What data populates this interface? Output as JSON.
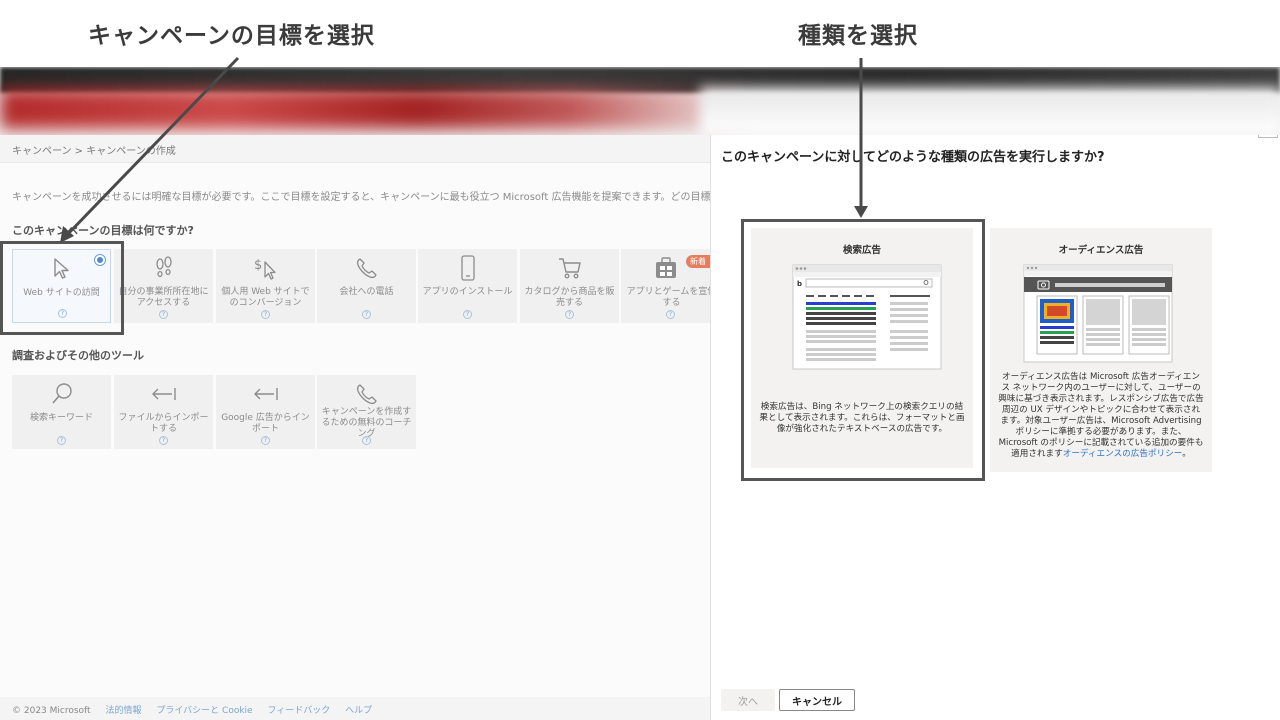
{
  "annotations": {
    "left_title": "キャンペーンの目標を選択",
    "right_title": "種類を選択"
  },
  "breadcrumb": "キャンペーン > キャンペーンの作成",
  "intro": "キャンペーンを成功させるには明確な目標が必要です。ここで目標を設定すると、キャンペーンに最も役立つ Microsoft 広告機能を提案できます。どの目標を選択して",
  "goals": {
    "heading": "このキャンペーンの目標は何ですか?",
    "new_badge": "新着",
    "items": [
      {
        "label": "Web サイトの訪問",
        "icon": "cursor-icon"
      },
      {
        "label": "自分の事業所所在地にアクセスする",
        "icon": "footprints-icon"
      },
      {
        "label": "個人用 Web サイトでのコンバージョン",
        "icon": "dollar-cursor-icon"
      },
      {
        "label": "会社への電話",
        "icon": "phone-icon"
      },
      {
        "label": "アプリのインストール",
        "icon": "mobile-icon"
      },
      {
        "label": "カタログから商品を販売する",
        "icon": "cart-icon"
      },
      {
        "label": "アプリとゲームを宣伝する",
        "icon": "game-icon"
      }
    ],
    "help_glyph": "?"
  },
  "tools": {
    "heading": "調査およびその他のツール",
    "items": [
      {
        "label": "検索キーワード",
        "icon": "search-icon"
      },
      {
        "label": "ファイルからインポートする",
        "icon": "import-icon"
      },
      {
        "label": "Google 広告からインポート",
        "icon": "import-icon"
      },
      {
        "label": "キャンペーンを作成するための無料のコーチング",
        "icon": "phone-icon"
      }
    ]
  },
  "footer": {
    "copyright": "© 2023 Microsoft",
    "links": [
      "法的情報",
      "プライバシーと Cookie",
      "フィードバック",
      "ヘルプ"
    ]
  },
  "panel": {
    "question": "このキャンペーンに対してどのような種類の広告を実行しますか?",
    "search_card": {
      "title": "検索広告",
      "description": "検索広告は、Bing ネットワーク上の検索クエリの結果として表示されます。これらは、フォーマットと画像が強化されたテキストベースの広告です。"
    },
    "audience_card": {
      "title": "オーディエンス広告",
      "description": "オーディエンス広告は Microsoft 広告オーディエンス ネットワーク内のユーザーに対して、ユーザーの興味に基づき表示されます。レスポンシブ広告で広告周辺の UX デザインやトピックに合わせて表示されます。対象ユーザー広告は、Microsoft Advertising ポリシーに準拠する必要があります。また、Microsoft のポリシーに記載されている追加の要件も適用されます",
      "policy_link": "オーディエンスの広告ポリシー",
      "link_suffix": "。"
    },
    "next_label": "次へ",
    "cancel_label": "キャンセル"
  },
  "colors": {
    "accent_blue": "#2b71c4",
    "badge_orange": "#e87d5e",
    "frame_dark": "#555555"
  }
}
